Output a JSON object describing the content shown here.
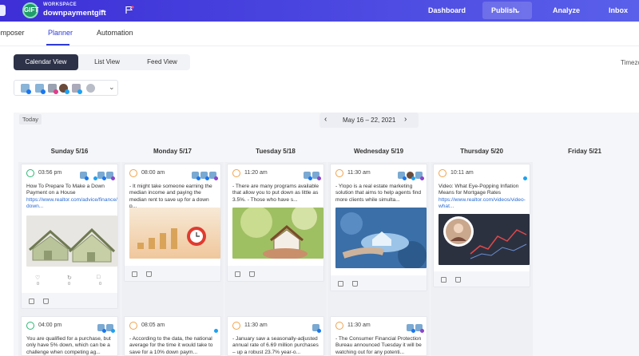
{
  "header": {
    "workspace_label": "WORKSPACE",
    "workspace_name": "downpaymentgift",
    "logo_text": "GIFT",
    "nav": {
      "dashboard": "Dashboard",
      "publish": "Publish",
      "analyze": "Analyze",
      "inbox": "Inbox"
    }
  },
  "subtabs": {
    "composer": "Composer",
    "planner": "Planner",
    "automation": "Automation"
  },
  "views": {
    "calendar": "Calendar View",
    "list": "List View",
    "feed": "Feed View"
  },
  "timezone_label": "Timezo",
  "calendar": {
    "today": "Today",
    "range": "May 16 – 22, 2021",
    "days": [
      "Sunday 5/16",
      "Monday 5/17",
      "Tuesday 5/18",
      "Wednesday 5/19",
      "Thursday 5/20",
      "Friday 5/21"
    ]
  },
  "posts_row1": [
    {
      "time": "03:56 pm",
      "text": "How To Prepare To Make a Down Payment on a House",
      "link": "https://www.realtor.com/advice/finance/prepare-down...",
      "stats": [
        "0",
        "0",
        "0"
      ]
    },
    {
      "time": "08:00 am",
      "text": "- It might take someone earning the median income and paying the median rent to save up for a down p...",
      "link": ""
    },
    {
      "time": "11:20 am",
      "text": "- There are many programs available that allow you to put down as little as 3.5%. - Those who have s...",
      "link": ""
    },
    {
      "time": "11:30 am",
      "text": "- Ylopo is a real estate marketing solution that aims to help agents find more clients while simulta...",
      "link": ""
    },
    {
      "time": "10:11 am",
      "text": "Video: What Eye-Popping Inflation Means for Mortgage Rates",
      "link": "https://www.realtor.com/videos/video-what..."
    }
  ],
  "posts_row2": [
    {
      "time": "04:00 pm",
      "text": "You are qualified for a purchase, but only have 5% down, which can be a challenge when competing ag..."
    },
    {
      "time": "08:05 am",
      "text": "- According to the data, the national average for the time it would take to save for a 10% down paym..."
    },
    {
      "time": "11:30 am",
      "text": "- January saw a seasonally-adjusted annual rate of 6.69 million purchases – up a robust 23.7% year-o..."
    },
    {
      "time": "11:30 am",
      "text": "- The Consumer Financial Protection Bureau announced Tuesday it will be watching out for any potenti..."
    }
  ],
  "colors": {
    "accent": "#2f3bd8",
    "header": "#4a46e0",
    "scheduled": "#f2a24a",
    "published": "#2bb673",
    "link": "#2a6bd2"
  }
}
